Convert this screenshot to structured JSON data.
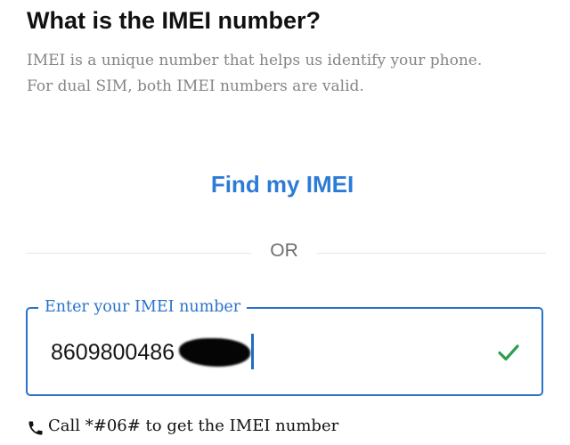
{
  "header": {
    "title": "What is the IMEI number?",
    "description_line1": "IMEI is a unique number that helps us identify your phone.",
    "description_line2": "For dual SIM, both IMEI numbers are valid."
  },
  "find_link": {
    "label": "Find my IMEI"
  },
  "divider": {
    "label": "OR"
  },
  "imei_field": {
    "label": "Enter your IMEI number",
    "value_visible": "8609800486",
    "valid": true,
    "status_icon": "check-icon"
  },
  "hint": {
    "icon": "phone-icon",
    "text": "Call *#06# to get the IMEI number"
  },
  "colors": {
    "accent": "#2a73c8",
    "link": "#2c7bd6",
    "success": "#2e9e4f"
  }
}
